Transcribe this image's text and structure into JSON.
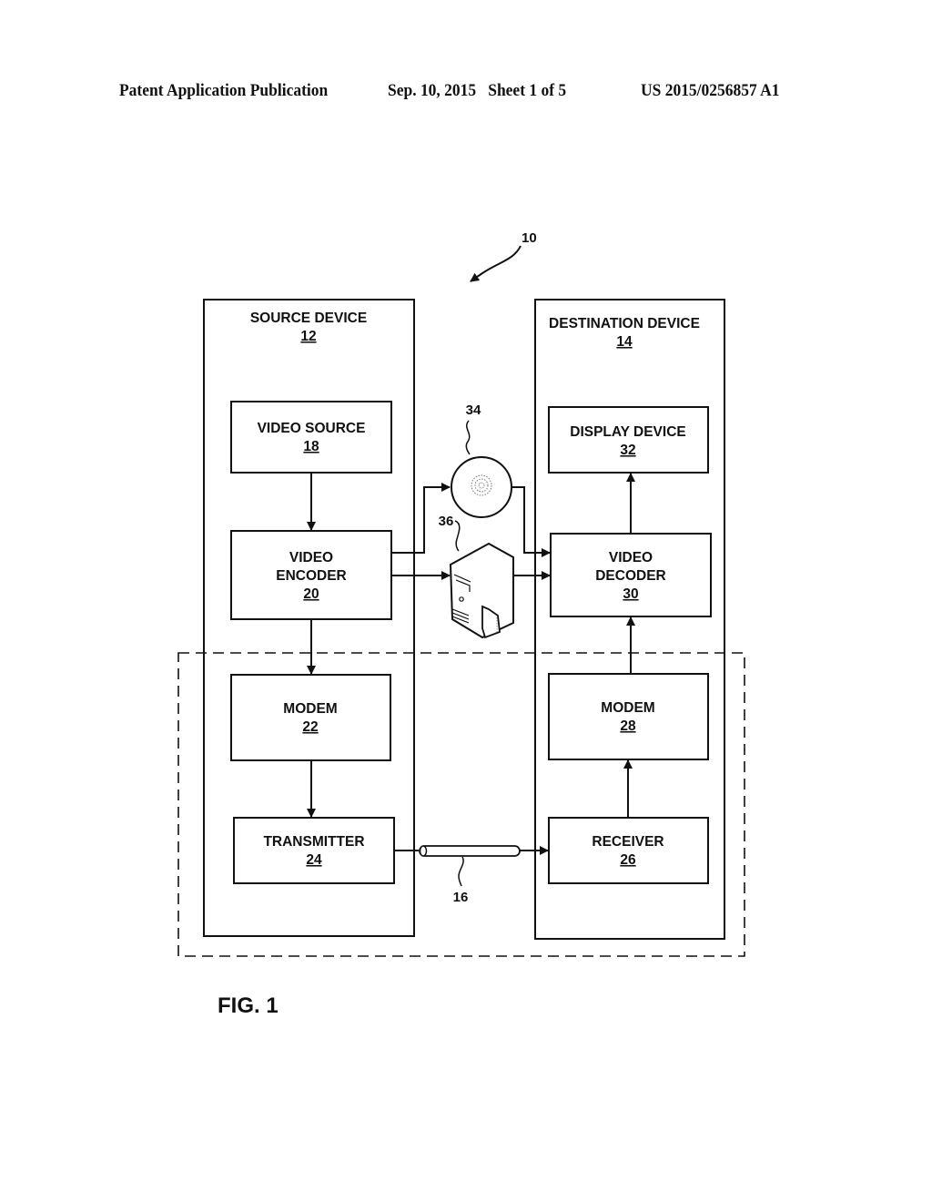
{
  "header": {
    "publication": "Patent Application Publication",
    "date_sheet": "Sep. 10, 2015   Sheet 1 of 5",
    "patent_number": "US 2015/0256857 A1"
  },
  "figure": {
    "label": "FIG. 1",
    "system_ref": "10",
    "source_device": {
      "title": "SOURCE DEVICE",
      "ref": "12"
    },
    "destination_device": {
      "title": "DESTINATION DEVICE",
      "ref": "14"
    },
    "blocks": {
      "video_source": {
        "line1": "VIDEO SOURCE",
        "ref": "18"
      },
      "video_encoder": {
        "line1": "VIDEO",
        "line2": "ENCODER",
        "ref": "20"
      },
      "modem_src": {
        "line1": "MODEM",
        "ref": "22"
      },
      "transmitter": {
        "line1": "TRANSMITTER",
        "ref": "24"
      },
      "display_device": {
        "line1": "DISPLAY DEVICE",
        "ref": "32"
      },
      "video_decoder": {
        "line1": "VIDEO",
        "line2": "DECODER",
        "ref": "30"
      },
      "modem_dst": {
        "line1": "MODEM",
        "ref": "28"
      },
      "receiver": {
        "line1": "RECEIVER",
        "ref": "26"
      }
    },
    "storage_medium_ref": "34",
    "file_server_ref": "36",
    "channel_ref": "16"
  }
}
